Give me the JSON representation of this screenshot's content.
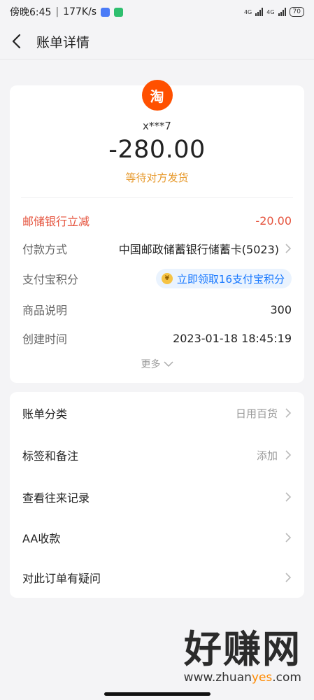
{
  "status_bar": {
    "time_text": "傍晚6:45",
    "speed_text": "177K/s",
    "network_1": "4G",
    "network_2": "4G",
    "battery": "70"
  },
  "nav": {
    "title": "账单详情"
  },
  "bill": {
    "merchant_logo_text": "淘",
    "merchant_name": "x***7",
    "amount": "-280.00",
    "status": "等待对方发货",
    "discount_label": "邮储银行立减",
    "discount_value": "-20.00",
    "payment_label": "付款方式",
    "payment_value": "中国邮政储蓄银行储蓄卡(5023)",
    "points_label": "支付宝积分",
    "points_value": "立即领取16支付宝积分",
    "desc_label": "商品说明",
    "desc_value": "300",
    "time_label": "创建时间",
    "time_value": "2023-01-18 18:45:19",
    "more_label": "更多"
  },
  "actions": {
    "category_label": "账单分类",
    "category_value": "日用百货",
    "tag_label": "标签和备注",
    "tag_value": "添加",
    "history_label": "查看往来记录",
    "aa_label": "AA收款",
    "question_label": "对此订单有疑问"
  },
  "watermark": {
    "main": "好赚网",
    "domain_prefix": "www.zhuan",
    "domain_highlight": "yes",
    "domain_suffix": ".com"
  },
  "colors": {
    "accent_orange": "#e79a2e",
    "discount_red": "#e5533d",
    "link_blue": "#1677ff",
    "taobao_orange": "#ff5000"
  }
}
